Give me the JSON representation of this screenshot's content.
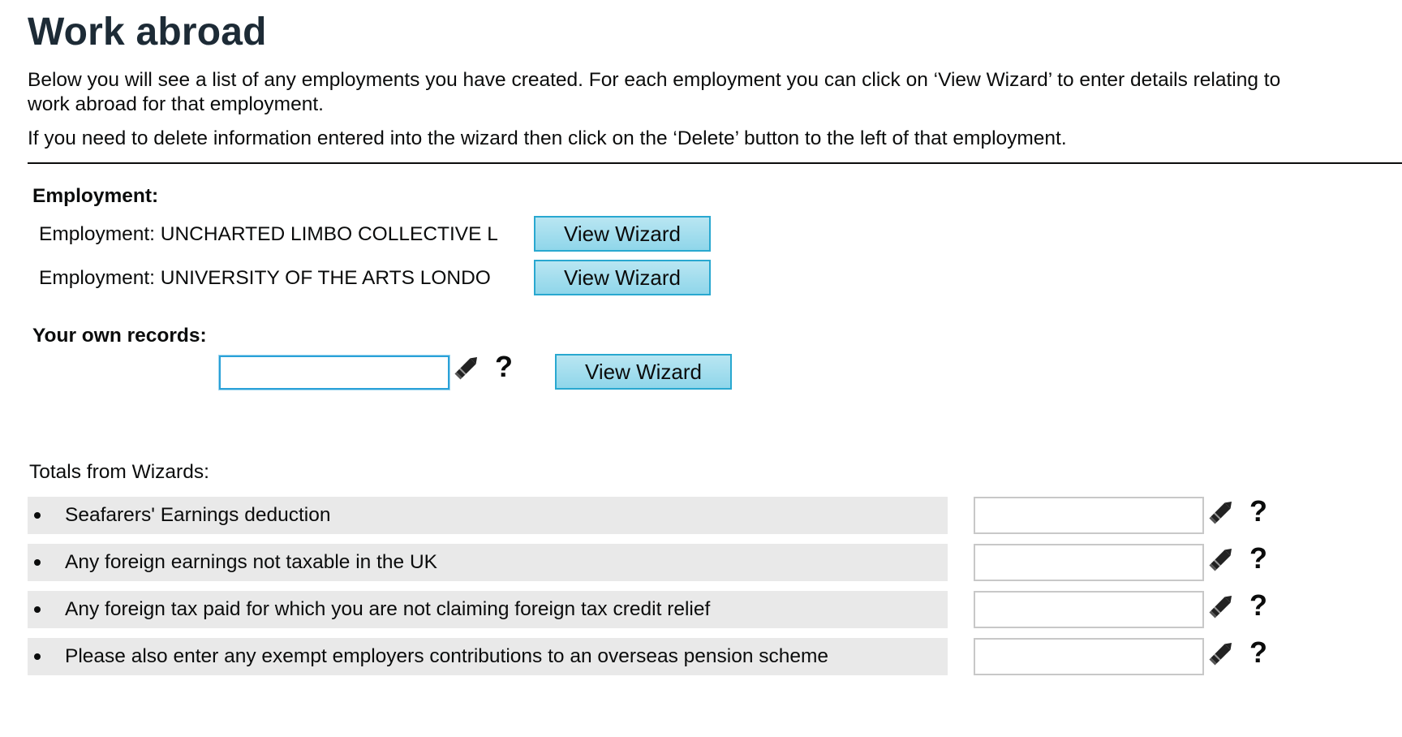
{
  "page": {
    "title": "Work abroad",
    "intro_1": "Below you will see a list of any employments you have created. For each employment you can click on ‘View Wizard’ to enter details relating to work abroad for that employment.",
    "intro_2": "If you need to delete information entered into the wizard then click on the ‘Delete’ button to the left of that employment."
  },
  "employment": {
    "heading": "Employment:",
    "items": [
      {
        "label": "Employment: UNCHARTED LIMBO COLLECTIVE L",
        "button": "View Wizard"
      },
      {
        "label": "Employment: UNIVERSITY OF THE ARTS LONDO",
        "button": "View Wizard"
      }
    ]
  },
  "own_records": {
    "heading": "Your own records:",
    "input_value": "",
    "button": "View Wizard",
    "help_label": "?",
    "edit_icon": "pencil-icon"
  },
  "totals": {
    "heading": "Totals from Wizards:",
    "items": [
      {
        "label": "Seafarers' Earnings deduction",
        "value": "",
        "help_label": "?"
      },
      {
        "label": "Any foreign earnings not taxable in the UK",
        "value": "",
        "help_label": "?"
      },
      {
        "label": "Any foreign tax paid for which you are not claiming foreign tax credit relief",
        "value": "",
        "help_label": "?"
      },
      {
        "label": "Please also enter any exempt employers contributions to an overseas pension scheme",
        "value": "",
        "help_label": "?"
      }
    ]
  },
  "colors": {
    "button_fill": "#a6dff0",
    "button_border": "#29a8d0",
    "focus_border": "#2aa1d8",
    "row_background": "#e9e9e9",
    "title_color": "#1d2b36"
  }
}
